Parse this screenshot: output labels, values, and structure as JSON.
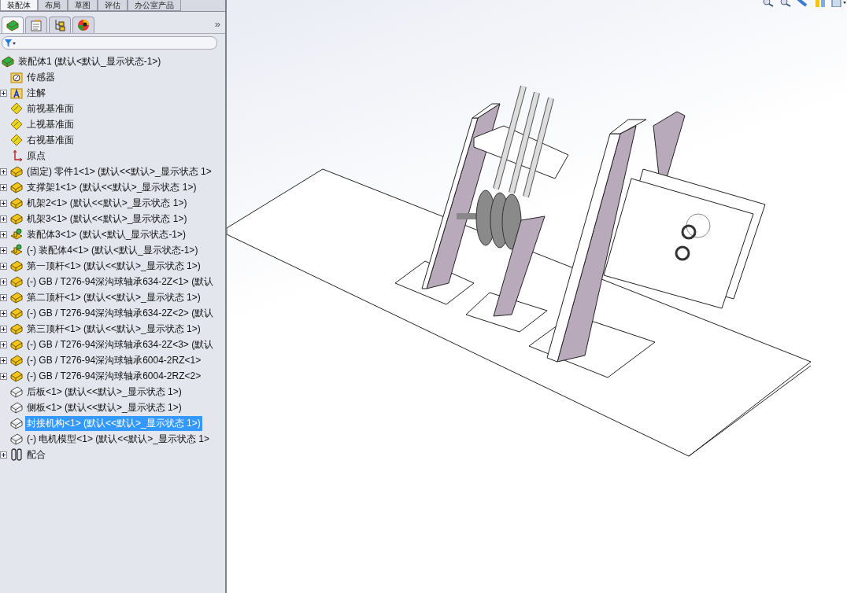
{
  "command_tabs": [
    {
      "label": "装配体",
      "selected": true
    },
    {
      "label": "布局",
      "selected": false
    },
    {
      "label": "草图",
      "selected": false
    },
    {
      "label": "评估",
      "selected": false
    },
    {
      "label": "办公室产品",
      "selected": false
    }
  ],
  "manager_tabs": [
    {
      "kind": "feature",
      "selected": true
    },
    {
      "kind": "property",
      "selected": false
    },
    {
      "kind": "config",
      "selected": false
    },
    {
      "kind": "appearance",
      "selected": false
    }
  ],
  "more_tabs": "»",
  "tree": {
    "label": "装配体1  (默认<默认_显示状态-1>)",
    "kind": "assembly",
    "children": [
      {
        "label": "传感器",
        "kind": "sensor",
        "selected": false
      },
      {
        "label": "注解",
        "kind": "annotation",
        "expanded": false,
        "selected": false
      },
      {
        "label": "前视基准面",
        "kind": "plane",
        "selected": false
      },
      {
        "label": "上视基准面",
        "kind": "plane",
        "selected": false
      },
      {
        "label": "右视基准面",
        "kind": "plane",
        "selected": false
      },
      {
        "label": "原点",
        "kind": "origin",
        "selected": false
      },
      {
        "label": "(固定) 零件1<1> (默认<<默认>_显示状态 1>",
        "kind": "part",
        "expanded": false,
        "selected": false
      },
      {
        "label": "支撑架1<1> (默认<<默认>_显示状态 1>)",
        "kind": "part",
        "expanded": false,
        "selected": false
      },
      {
        "label": "机架2<1> (默认<<默认>_显示状态 1>)",
        "kind": "part",
        "expanded": false,
        "selected": false
      },
      {
        "label": "机架3<1> (默认<<默认>_显示状态 1>)",
        "kind": "part",
        "expanded": false,
        "selected": false
      },
      {
        "label": "装配体3<1> (默认<默认_显示状态-1>)",
        "kind": "subassembly",
        "expanded": false,
        "selected": false
      },
      {
        "label": "(-) 装配体4<1> (默认<默认_显示状态-1>)",
        "kind": "subassembly",
        "expanded": false,
        "selected": false
      },
      {
        "label": "第一顶杆<1> (默认<<默认>_显示状态 1>)",
        "kind": "part",
        "expanded": false,
        "selected": false
      },
      {
        "label": "(-) GB / T276-94深沟球轴承634-2Z<1> (默认",
        "kind": "part",
        "expanded": false,
        "selected": false
      },
      {
        "label": "第二顶杆<1> (默认<<默认>_显示状态 1>)",
        "kind": "part",
        "expanded": false,
        "selected": false
      },
      {
        "label": "(-) GB / T276-94深沟球轴承634-2Z<2> (默认",
        "kind": "part",
        "expanded": false,
        "selected": false
      },
      {
        "label": "第三顶杆<1> (默认<<默认>_显示状态 1>)",
        "kind": "part",
        "expanded": false,
        "selected": false
      },
      {
        "label": "(-) GB / T276-94深沟球轴承634-2Z<3> (默认",
        "kind": "part",
        "expanded": false,
        "selected": false
      },
      {
        "label": "(-) GB / T276-94深沟球轴承6004-2RZ<1>",
        "kind": "part",
        "expanded": false,
        "selected": false
      },
      {
        "label": "(-) GB / T276-94深沟球轴承6004-2RZ<2>",
        "kind": "part",
        "expanded": false,
        "selected": false
      },
      {
        "label": "后板<1> (默认<<默认>_显示状态 1>)",
        "kind": "part-outline",
        "selected": false
      },
      {
        "label": "侧板<1> (默认<<默认>_显示状态 1>)",
        "kind": "part-outline",
        "selected": false
      },
      {
        "label": "封接机构<1> (默认<<默认>_显示状态 1>)",
        "kind": "part-outline",
        "selected": true
      },
      {
        "label": "(-) 电机模型<1> (默认<<默认>_显示状态 1>",
        "kind": "part-outline",
        "selected": false
      },
      {
        "label": "配合",
        "kind": "mates",
        "expanded": false,
        "selected": false
      }
    ]
  },
  "view_tools": [
    {
      "kind": "zoom-fit"
    },
    {
      "kind": "zoom-area"
    },
    {
      "kind": "previous-view"
    },
    {
      "kind": "section"
    },
    {
      "kind": "orientation"
    }
  ]
}
